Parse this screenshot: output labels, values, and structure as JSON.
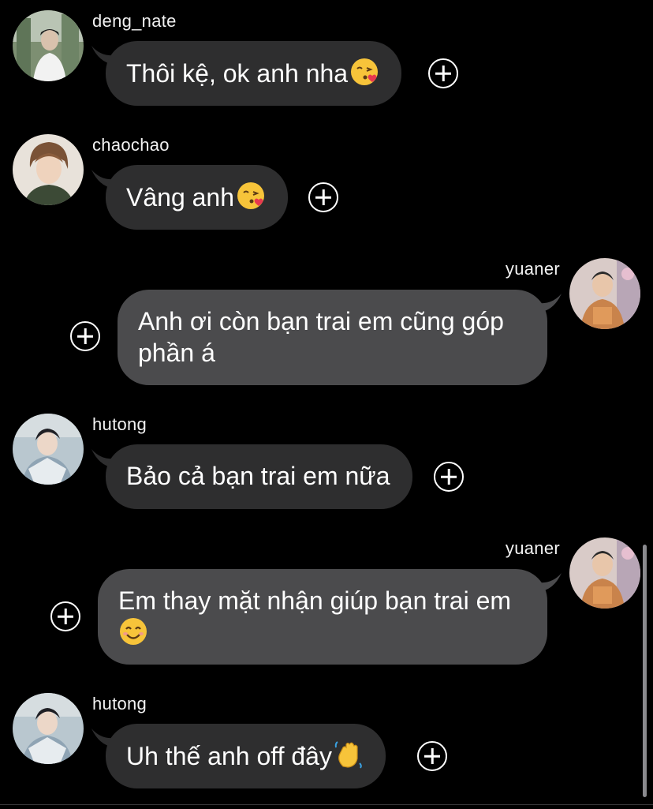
{
  "colors": {
    "background": "#000000",
    "bubble_other": "#2e2e2f",
    "bubble_self": "#4b4b4d",
    "text": "#ffffff"
  },
  "messages": [
    {
      "username": "deng_nate",
      "text": "Thôi kệ, ok anh nha",
      "emoji": "kissing-heart-emoji",
      "side": "left"
    },
    {
      "username": "chaochao",
      "text": "Vâng anh",
      "emoji": "kissing-heart-emoji",
      "side": "left"
    },
    {
      "username": "yuaner",
      "text": "Anh ơi còn bạn trai em cũng góp\nphần á",
      "emoji": "",
      "side": "right"
    },
    {
      "username": "hutong",
      "text": "Bảo cả bạn trai em nữa",
      "emoji": "",
      "side": "left"
    },
    {
      "username": "yuaner",
      "text": "Em thay mặt nhận giúp bạn trai em\n",
      "emoji": "smiling-face-emoji",
      "side": "right"
    },
    {
      "username": "hutong",
      "text": "Uh thế anh off đây",
      "emoji": "waving-hand-emoji",
      "side": "left"
    }
  ],
  "icons": {
    "react": "add-reaction-icon"
  }
}
